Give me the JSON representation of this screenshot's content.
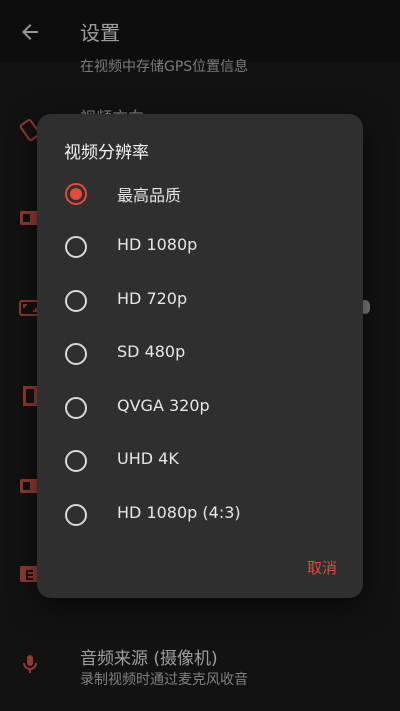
{
  "appbar": {
    "title": "设置"
  },
  "settings": {
    "gps_subtext": "在视频中存储GPS位置信息",
    "partial_title": "视频方向",
    "audio_source_title": "音频来源 (摄像机)",
    "audio_source_sub": "录制视频时通过麦克风收音"
  },
  "dialog": {
    "title": "视频分辨率",
    "options": [
      {
        "label": "最高品质",
        "selected": true
      },
      {
        "label": "HD 1080p",
        "selected": false
      },
      {
        "label": "HD 720p",
        "selected": false
      },
      {
        "label": "SD 480p",
        "selected": false
      },
      {
        "label": "QVGA 320p",
        "selected": false
      },
      {
        "label": "UHD 4K",
        "selected": false
      },
      {
        "label": "HD 1080p (4:3)",
        "selected": false
      }
    ],
    "cancel_label": "取消"
  },
  "colors": {
    "accent": "#e24a3a",
    "dialog_bg": "#2f2f2f",
    "appbar_bg": "#151515"
  },
  "icons": [
    "back-arrow-icon",
    "rotate-icon",
    "hd-icon",
    "aspect-ratio-icon",
    "film-icon",
    "hd-icon",
    "e-icon",
    "microphone-icon"
  ]
}
